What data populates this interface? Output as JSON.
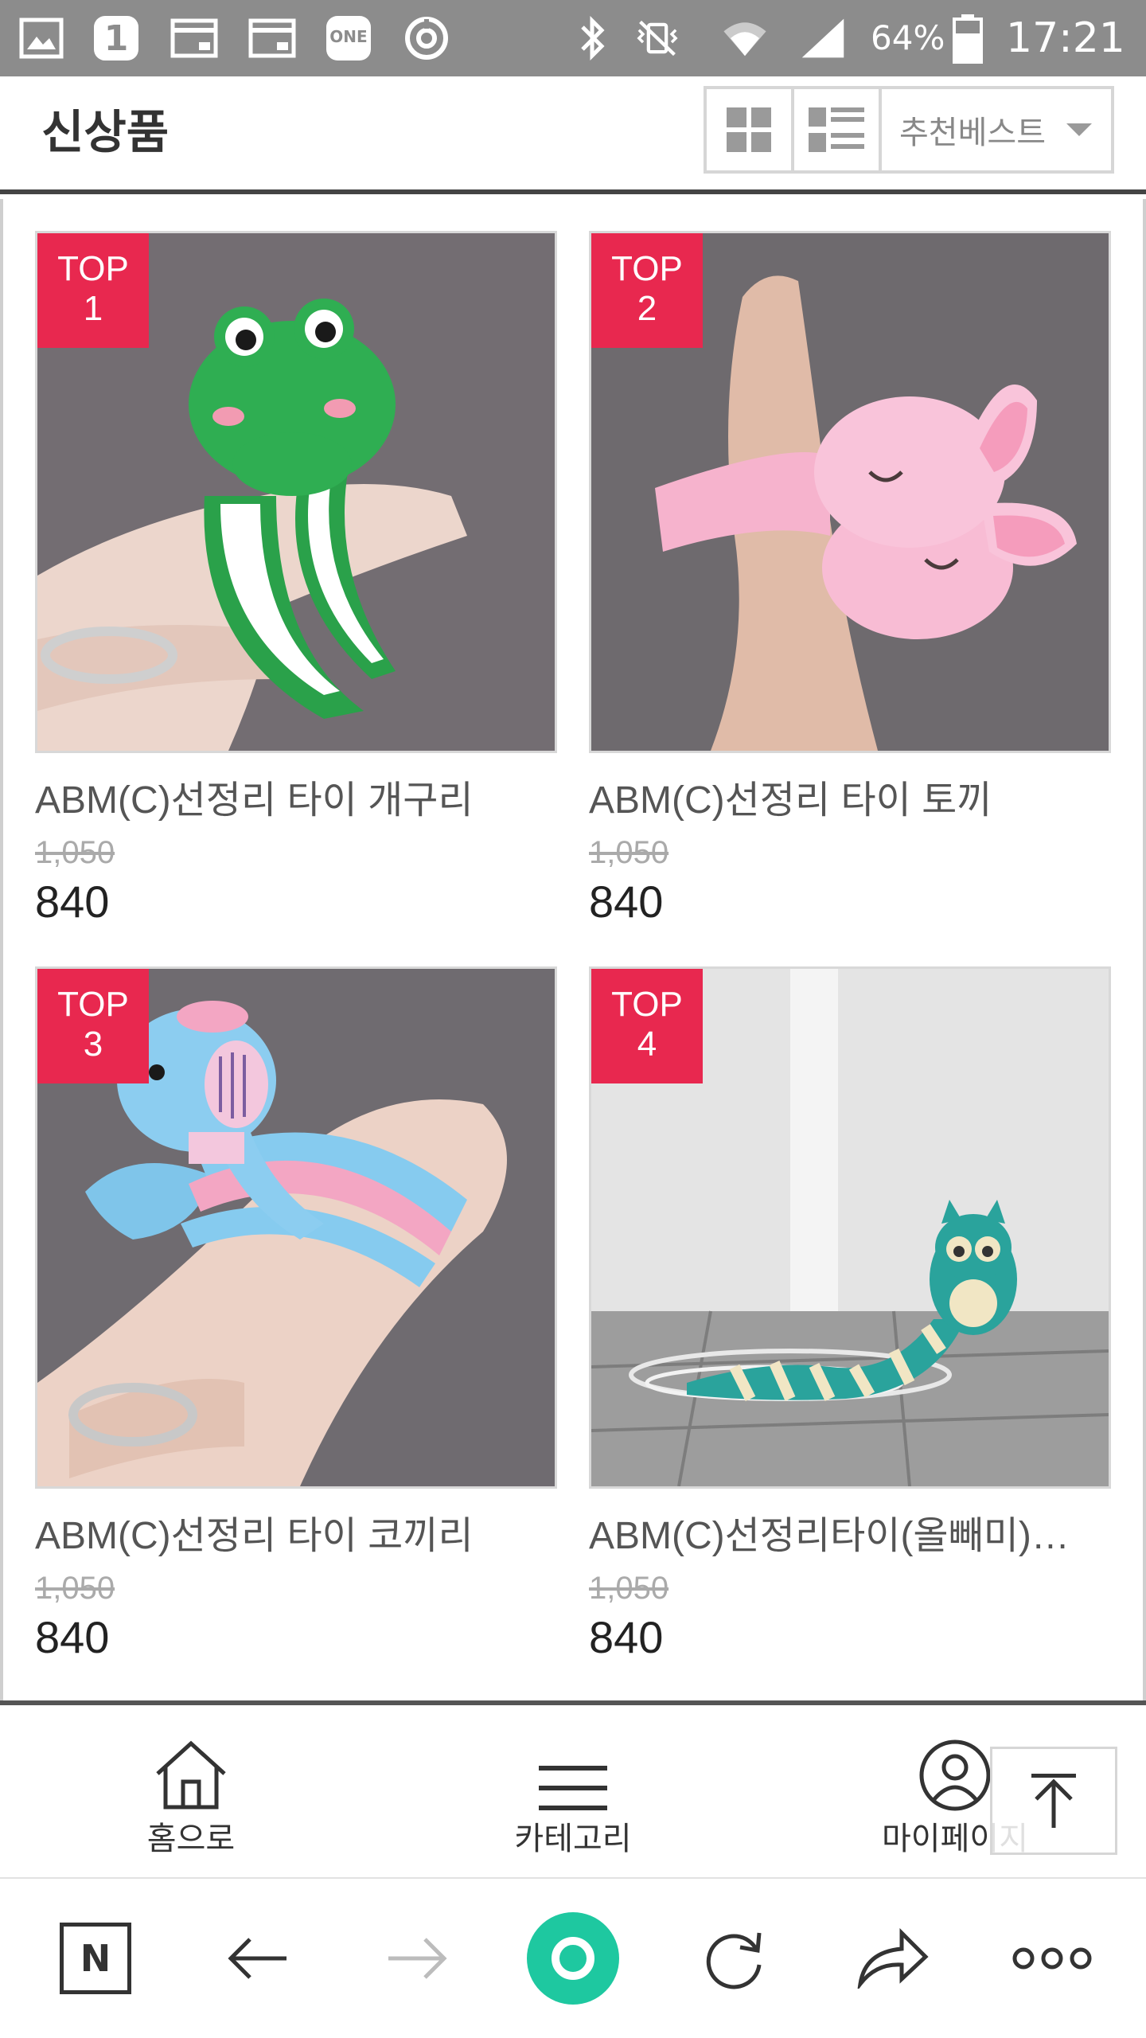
{
  "status_bar": {
    "battery_percent": "64%",
    "time": "17:21",
    "notification_icons": [
      "gallery-icon",
      "one-badge-icon",
      "card-icon",
      "card-icon",
      "one-service-icon",
      "sync-icon"
    ],
    "one_service_label": "ONE",
    "one_badge_label": "1"
  },
  "header": {
    "title": "신상품",
    "sort_label": "추천베스트"
  },
  "products": [
    {
      "badge_top": "TOP",
      "badge_rank": "1",
      "name": "ABM(C)선정리 타이 개구리",
      "original_price": "1,050",
      "price": "840"
    },
    {
      "badge_top": "TOP",
      "badge_rank": "2",
      "name": "ABM(C)선정리 타이 토끼",
      "original_price": "1,050",
      "price": "840"
    },
    {
      "badge_top": "TOP",
      "badge_rank": "3",
      "name": "ABM(C)선정리 타이 코끼리",
      "original_price": "1,050",
      "price": "840"
    },
    {
      "badge_top": "TOP",
      "badge_rank": "4",
      "name": "ABM(C)선정리타이(올빼미)…",
      "original_price": "1,050",
      "price": "840"
    }
  ],
  "bottom_nav": {
    "home_label": "홈으로",
    "category_label": "카테고리",
    "mypage_label": "마이페이지"
  },
  "browser": {
    "naver_label": "N"
  },
  "colors": {
    "badge": "#e8284f",
    "status_bar": "#8c8c8c",
    "browser_home": "#1ec8a0"
  }
}
